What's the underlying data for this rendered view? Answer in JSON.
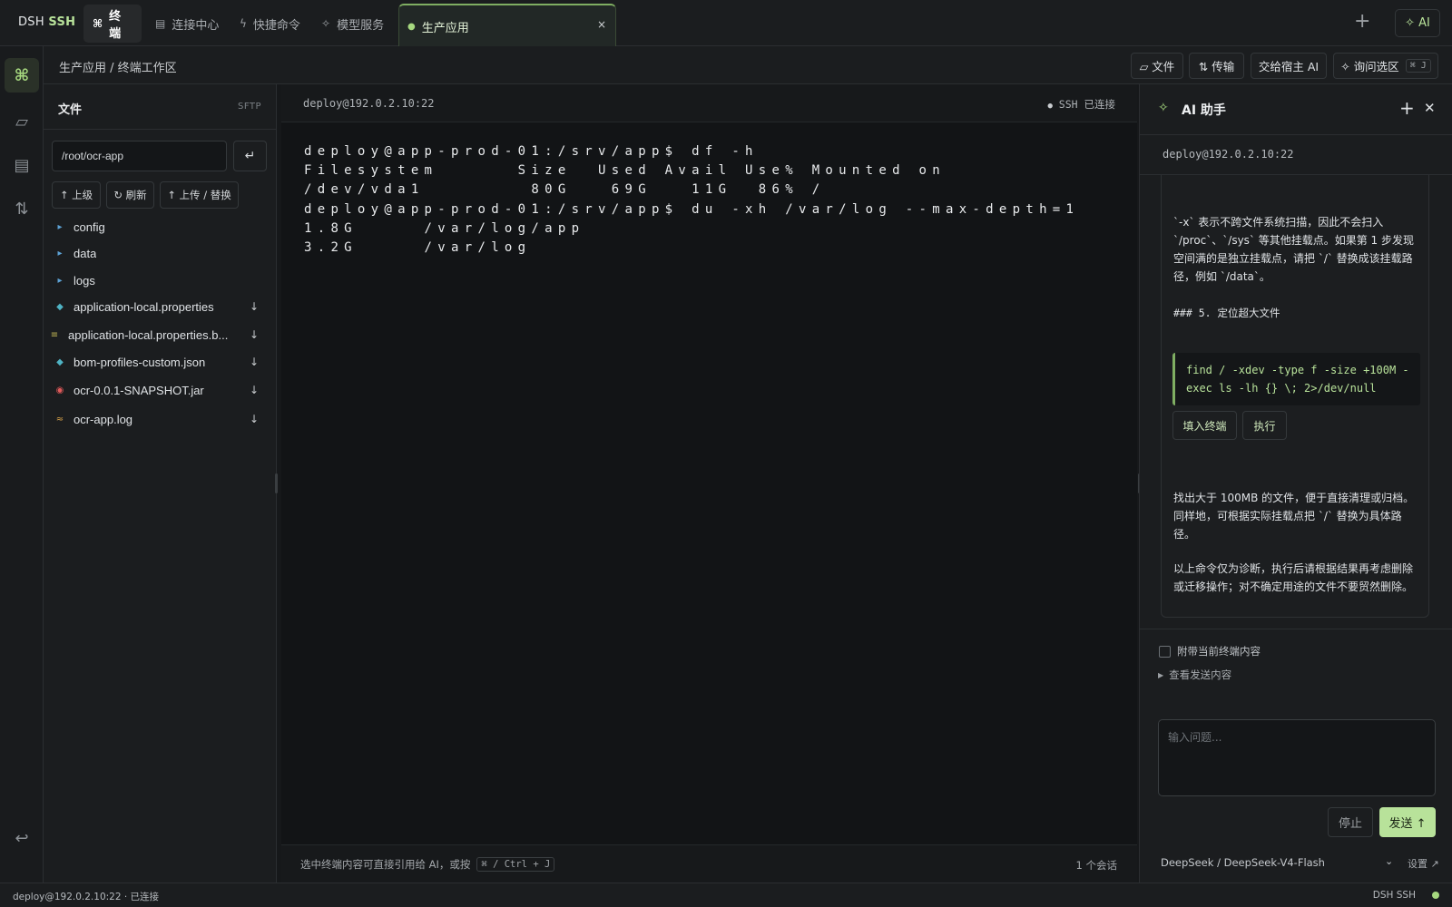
{
  "brand": {
    "part1": "DSH",
    "part2": "SSH"
  },
  "top_tabs": [
    {
      "icon": "⌘",
      "label": "终端"
    },
    {
      "icon": "▤",
      "label": "连接中心"
    },
    {
      "icon": "ϟ",
      "label": "快捷命令"
    },
    {
      "icon": "✧",
      "label": "模型服务"
    }
  ],
  "session_tab": {
    "label": "生产应用",
    "close": "×"
  },
  "top_actions": {
    "plus": "+",
    "ai_label": "✧ AI"
  },
  "breadcrumb": "生产应用 / 终端工作区",
  "toolbar": {
    "file": "▱ 文件",
    "transfer": "⇅ 传输",
    "handoff": "交给宿主 AI",
    "ask": "✧ 询问选区",
    "ask_kbd": "⌘ J"
  },
  "file_panel": {
    "title": "文件",
    "protocol": "SFTP",
    "path": "/root/ocr-app",
    "go": "↵",
    "buttons": {
      "up": "↑ 上级",
      "refresh": "↻ 刷新",
      "upload": "↑ 上传 / 替换"
    },
    "items": [
      {
        "icon": "▸",
        "kind": "dir",
        "name": "config"
      },
      {
        "icon": "▸",
        "kind": "dir",
        "name": "data"
      },
      {
        "icon": "▸",
        "kind": "dir",
        "name": "logs"
      },
      {
        "icon": "◆",
        "kind": "props",
        "name": "application-local.properties",
        "download": "↓"
      },
      {
        "icon": "≡",
        "kind": "bak",
        "name": "application-local.properties.b...",
        "download": "↓"
      },
      {
        "icon": "◆",
        "kind": "json",
        "name": "bom-profiles-custom.json",
        "download": "↓"
      },
      {
        "icon": "◉",
        "kind": "jar",
        "name": "ocr-0.0.1-SNAPSHOT.jar",
        "download": "↓"
      },
      {
        "icon": "≈",
        "kind": "log",
        "name": "ocr-app.log",
        "download": "↓"
      }
    ]
  },
  "terminal": {
    "host": "deploy@192.0.2.10:22",
    "status": "SSH 已连接",
    "lines": [
      "deploy@app-prod-01:/srv/app$ df -h",
      "Filesystem      Size  Used Avail Use% Mounted on",
      "/dev/vda1        80G   69G   11G  86% /",
      "deploy@app-prod-01:/srv/app$ du -xh /var/log --max-depth=1",
      "1.8G     /var/log/app",
      "3.2G     /var/log"
    ],
    "footer_hint": "选中终端内容可直接引用给 AI，或按",
    "footer_kbd": "⌘ / Ctrl + J",
    "sessions": "1 个会话"
  },
  "ai_panel": {
    "title": "AI 助手",
    "plus": "+",
    "close": "✕",
    "host": "deploy@192.0.2.10:22",
    "para1": "`-x` 表示不跨文件系统扫描，因此不会扫入 `/proc`、`/sys` 等其他挂载点。如果第 1 步发现空间满的是独立挂载点，请把 `/` 替换成该挂载路径，例如 `/data`。",
    "heading": "### 5. 定位超大文件",
    "code": "find / -xdev -type f -size +100M -exec ls -lh {} \\; 2>/dev/null",
    "fill_btn": "填入终端",
    "exec_btn": "执行",
    "para2": "找出大于 100MB 的文件，便于直接清理或归档。同样地，可根据实际挂载点把 `/` 替换为具体路径。",
    "para3": "以上命令仅为诊断，执行后请根据结果再考虑删除或迁移操作；对不确定用途的文件不要贸然删除。",
    "attach_label": "附带当前终端内容",
    "view_label": "查看发送内容",
    "input_placeholder": "输入问题...",
    "stop": "停止",
    "send": "发送 ↑",
    "model": "DeepSeek / DeepSeek-V4-Flash",
    "settings": "设置 ↗"
  },
  "statusbar": {
    "left": "deploy@192.0.2.10:22 · 已连接",
    "right": "DSH SSH"
  },
  "colors": {
    "accent": "#a6d87f",
    "send_bg": "#b8e29a",
    "background": "#16181a",
    "terminal_bg": "#121416"
  }
}
